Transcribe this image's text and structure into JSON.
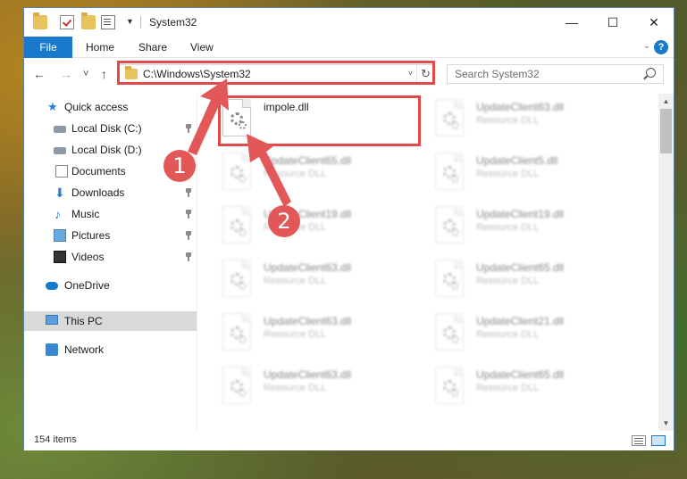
{
  "window": {
    "title": "System32",
    "controls": {
      "minimize": "—",
      "maximize": "☐",
      "close": "✕"
    }
  },
  "ribbon": {
    "tabs": [
      "File",
      "Home",
      "Share",
      "View"
    ],
    "expand": "⌄",
    "help": "?"
  },
  "nav": {
    "back": "←",
    "forward": "→",
    "recent": "˅",
    "up": "↑",
    "address": "C:\\Windows\\System32",
    "address_dropdown": "˅",
    "refresh": "↻",
    "search_placeholder": "Search System32"
  },
  "sidebar": {
    "items": [
      {
        "label": "Quick access",
        "icon": "star-icon",
        "pinned": false
      },
      {
        "label": "Local Disk (C:)",
        "icon": "disk-icon",
        "pinned": true
      },
      {
        "label": "Local Disk (D:)",
        "icon": "disk-icon",
        "pinned": false
      },
      {
        "label": "Documents",
        "icon": "document-icon",
        "pinned": true
      },
      {
        "label": "Downloads",
        "icon": "download-icon",
        "pinned": true
      },
      {
        "label": "Music",
        "icon": "music-icon",
        "pinned": true
      },
      {
        "label": "Pictures",
        "icon": "pictures-icon",
        "pinned": true
      },
      {
        "label": "Videos",
        "icon": "videos-icon",
        "pinned": true
      },
      {
        "label": "OneDrive",
        "icon": "onedrive-icon",
        "pinned": false
      },
      {
        "label": "This PC",
        "icon": "this-pc-icon",
        "pinned": false,
        "selected": true
      },
      {
        "label": "Network",
        "icon": "network-icon",
        "pinned": false
      }
    ]
  },
  "files": [
    {
      "name": "impole.dll",
      "type": "",
      "highlighted": true
    },
    {
      "name": "UpdateClient63.dll",
      "type": "Resource DLL"
    },
    {
      "name": "UpdateClient65.dll",
      "type": "Resource DLL"
    },
    {
      "name": "UpdateClient5.dll",
      "type": "Resource DLL"
    },
    {
      "name": "UpdateClient19.dll",
      "type": "Resource DLL"
    },
    {
      "name": "UpdateClient19.dll",
      "type": "Resource DLL"
    },
    {
      "name": "UpdateClient63.dll",
      "type": "Resource DLL"
    },
    {
      "name": "UpdateClient65.dll",
      "type": "Resource DLL"
    },
    {
      "name": "UpdateClient63.dll",
      "type": "Resource DLL"
    },
    {
      "name": "UpdateClient21.dll",
      "type": "Resource DLL"
    },
    {
      "name": "UpdateClient63.dll",
      "type": "Resource DLL"
    },
    {
      "name": "UpdateClient65.dll",
      "type": "Resource DLL"
    }
  ],
  "status": {
    "item_count": "154 items"
  },
  "annotations": {
    "step1": "1",
    "step2": "2",
    "color": "#e04a4a"
  },
  "colors": {
    "accent": "#1979ca",
    "highlight": "#e04a4a",
    "badge": "#e25858"
  }
}
